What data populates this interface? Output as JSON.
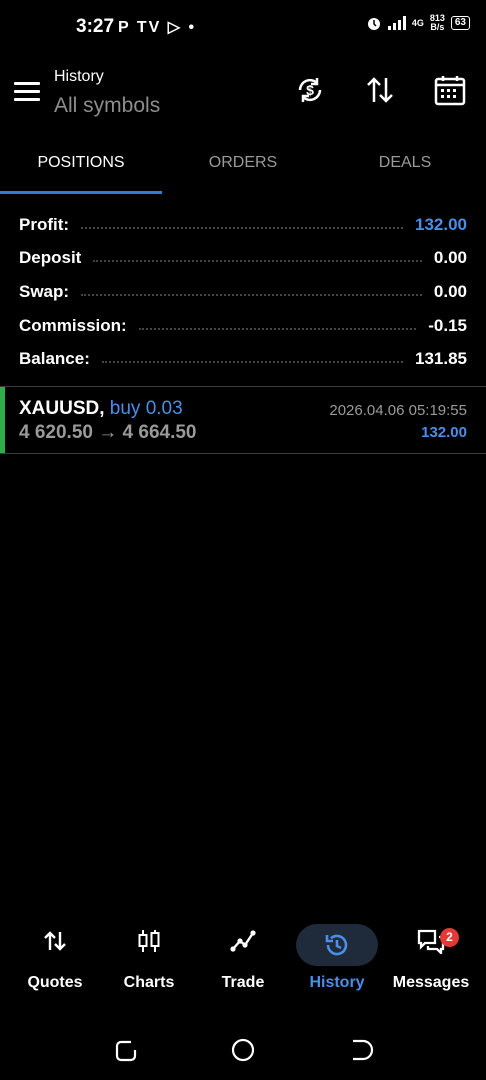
{
  "status_bar": {
    "time": "3:27",
    "apps": "P TV ▷ •",
    "network": "4G",
    "speed_top": "813",
    "speed_bottom": "B/s",
    "battery": "63"
  },
  "header": {
    "title": "History",
    "subtitle": "All symbols",
    "icons": [
      "refresh-currency-icon",
      "sort-icon",
      "calendar-icon"
    ]
  },
  "tabs": [
    {
      "label": "POSITIONS",
      "active": true
    },
    {
      "label": "ORDERS",
      "active": false
    },
    {
      "label": "DEALS",
      "active": false
    }
  ],
  "summary": [
    {
      "label": "Profit:",
      "value": "132.00",
      "highlight": true
    },
    {
      "label": "Deposit",
      "value": "0.00",
      "highlight": false
    },
    {
      "label": "Swap:",
      "value": "0.00",
      "highlight": false
    },
    {
      "label": "Commission:",
      "value": "-0.15",
      "highlight": false
    },
    {
      "label": "Balance:",
      "value": "131.85",
      "highlight": false
    }
  ],
  "position": {
    "symbol": "XAUUSD,",
    "side": "buy 0.03",
    "open_price": "4 620.50",
    "arrow": "→",
    "close_price": "4 664.50",
    "time": "2026.04.06 05:19:55",
    "profit": "132.00"
  },
  "bottom_nav": [
    {
      "label": "Quotes",
      "icon": "quotes-icon",
      "active": false
    },
    {
      "label": "Charts",
      "icon": "candlestick-icon",
      "active": false
    },
    {
      "label": "Trade",
      "icon": "trade-line-icon",
      "active": false
    },
    {
      "label": "History",
      "icon": "history-icon",
      "active": true
    },
    {
      "label": "Messages",
      "icon": "messages-icon",
      "active": false,
      "badge": "2"
    }
  ],
  "colors": {
    "accent": "#4a8ee8",
    "buy_bar": "#2fae4a",
    "badge": "#e53935"
  }
}
